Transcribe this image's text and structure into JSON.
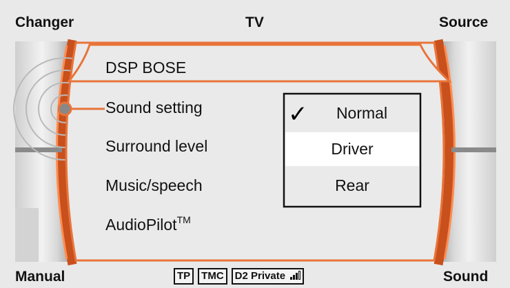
{
  "corners": {
    "top_left": "Changer",
    "top_center": "TV",
    "top_right": "Source",
    "bottom_left": "Manual",
    "bottom_right": "Sound"
  },
  "menu": {
    "title": "DSP BOSE",
    "items": [
      {
        "label": "Sound setting",
        "active": true
      },
      {
        "label": "Surround level"
      },
      {
        "label": "Music/speech"
      },
      {
        "label": "AudioPilot",
        "superscript": "TM"
      }
    ]
  },
  "submenu": {
    "checkmark": "✓",
    "options": [
      {
        "label": "Normal",
        "checked": true
      },
      {
        "label": "Driver",
        "highlighted": true
      },
      {
        "label": "Rear"
      }
    ]
  },
  "status": {
    "badges": [
      "TP",
      "TMC",
      "D2 Private"
    ],
    "signal_strength_bars": 3,
    "signal_max_bars": 4
  },
  "colors": {
    "accent": "#e8743a",
    "accent_dark": "#c8501c",
    "panel_gray": "#e8e8e8",
    "selection": "#ffffff"
  },
  "icons": {
    "selector_knob": "knob-indicator-icon",
    "signal": "signal-strength-icon"
  }
}
